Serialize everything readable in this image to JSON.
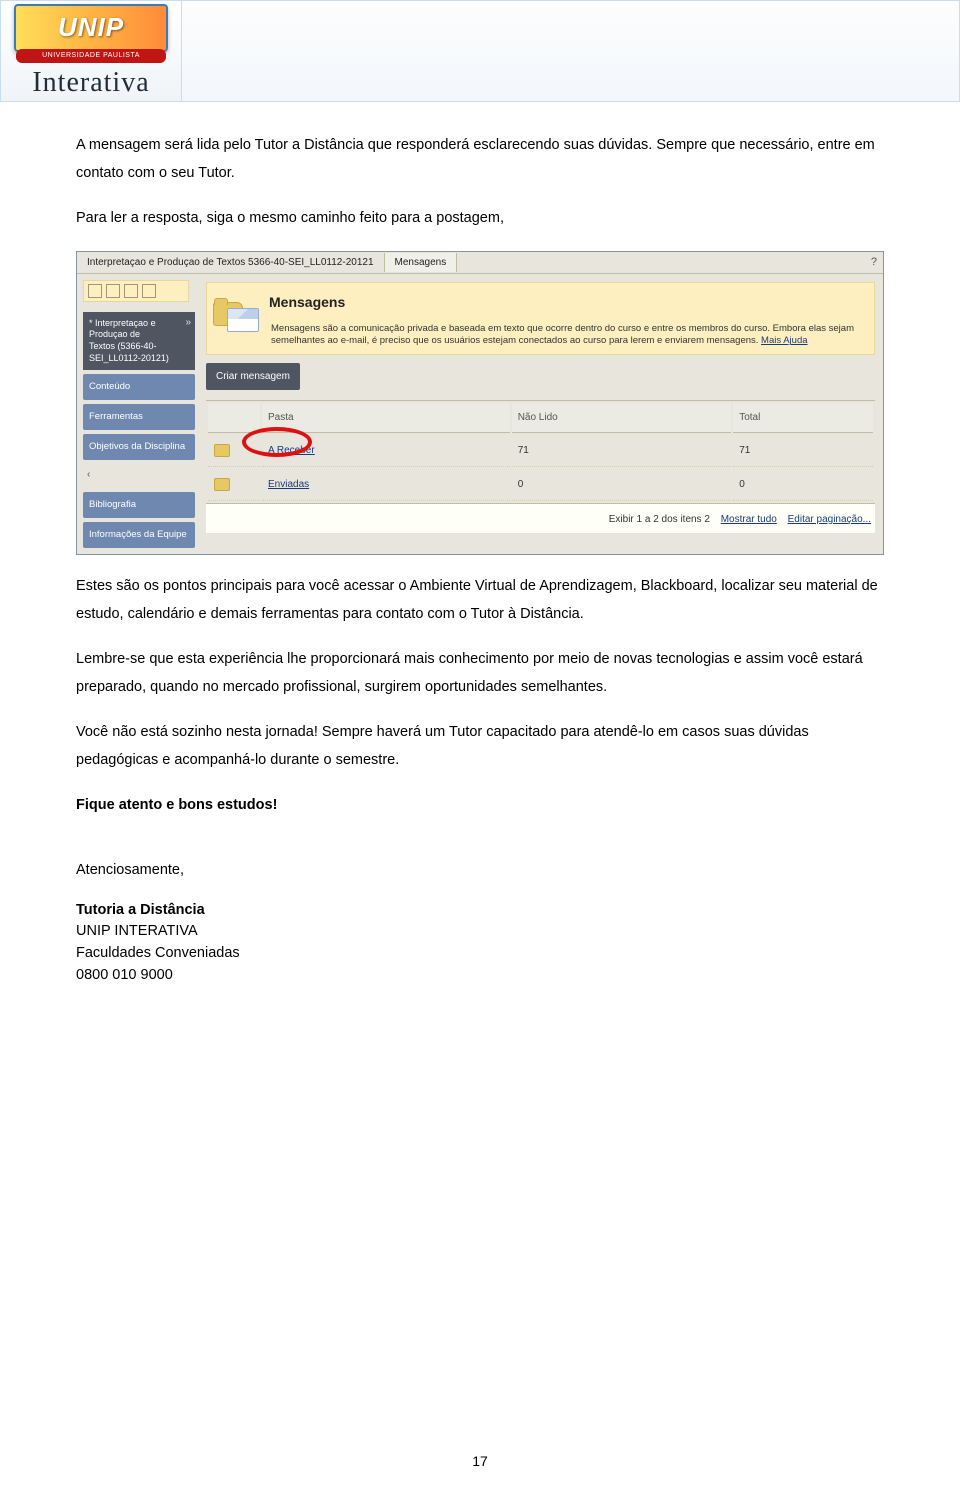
{
  "header": {
    "logo_text": "UNIP",
    "logo_sub": "UNIVERSIDADE PAULISTA",
    "brand": "Interativa"
  },
  "intro": {
    "p1": "A mensagem será lida pelo Tutor a Distância que responderá esclarecendo suas dúvidas. Sempre que necessário, entre em contato com o seu Tutor.",
    "p2": "Para ler a resposta, siga o mesmo caminho feito para a postagem,"
  },
  "shot": {
    "tab1": "Interpretaçao e Produçao de Textos 5366-40-SEI_LL0112-20121",
    "tab2": "Mensagens",
    "sidebar": {
      "course_prefix": "*",
      "course_line1": "Interpretaçao e",
      "course_line2": "Produçao de",
      "course_line3": "Textos (5366-40-",
      "course_line4": "SEI_LL0112-20121)",
      "items": [
        "Conteúdo",
        "Ferramentas",
        "Objetivos da Disciplina",
        "Bibliografia",
        "Informações da Equipe"
      ]
    },
    "panel": {
      "title": "Mensagens",
      "desc_a": "Mensagens são a comunicação privada e baseada em texto que ocorre dentro do curso e entre os membros do curso. Embora elas sejam semelhantes ao e-mail, é preciso que os usuários estejam conectados ao curso para lerem e enviarem mensagens. ",
      "desc_link": "Mais Ajuda",
      "create": "Criar mensagem",
      "cols": {
        "c1": "Pasta",
        "c2": "Não Lido",
        "c3": "Total"
      },
      "rows": [
        {
          "name": "A Receber",
          "unread": "71",
          "total": "71"
        },
        {
          "name": "Enviadas",
          "unread": "0",
          "total": "0"
        }
      ],
      "footer": {
        "status": "Exibir 1 a 2 dos itens 2",
        "showall": "Mostrar tudo",
        "edit": "Editar paginação..."
      }
    }
  },
  "body": {
    "p3": "Estes são os pontos principais para você acessar o Ambiente Virtual de Aprendizagem, Blackboard, localizar seu material de estudo, calendário e demais ferramentas para contato com o Tutor à Distância.",
    "p4": "Lembre-se que esta experiência lhe proporcionará mais conhecimento por meio de novas tecnologias e assim você estará preparado, quando no mercado profissional, surgirem oportunidades semelhantes.",
    "p5a": "Você não está sozinho nesta jornada! ",
    "p5b": "Sempre haverá um Tutor capacitado para atendê-lo em casos suas dúvidas pedagógicas e acompanhá-lo durante o semestre.",
    "signoff": "Fique atento e bons estudos!",
    "atenc": "Atenciosamente,",
    "sig1": "Tutoria a Distância",
    "sig2": "UNIP INTERATIVA",
    "sig3": "Faculdades Conveniadas",
    "sig4": "0800 010 9000"
  },
  "page_num": "17"
}
